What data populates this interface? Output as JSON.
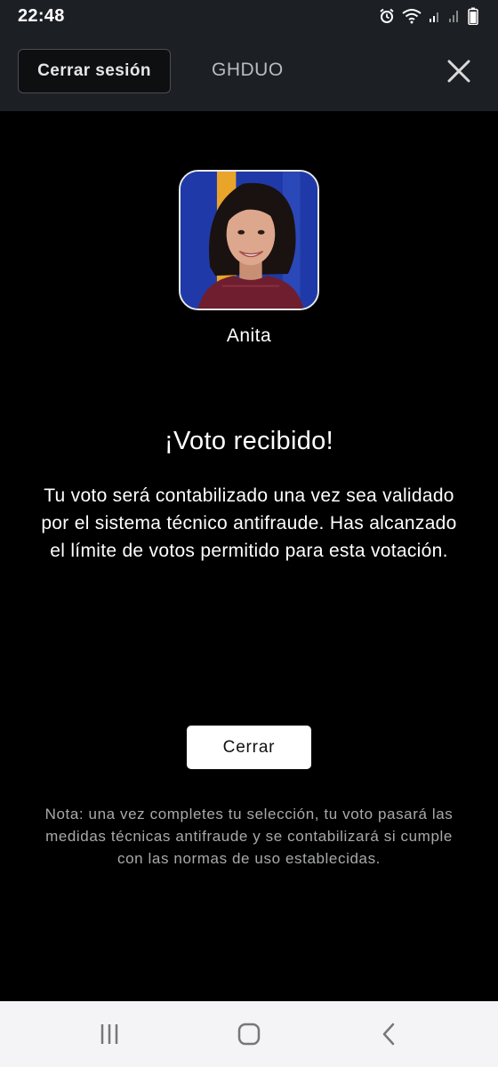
{
  "status_bar": {
    "time": "22:48",
    "icons": [
      "alarm-icon",
      "wifi-icon",
      "signal-icon",
      "signal-icon",
      "battery-icon"
    ]
  },
  "header": {
    "logout_label": "Cerrar sesión",
    "title": "GHDUO",
    "close_icon": "close-icon"
  },
  "contestant": {
    "name": "Anita",
    "photo_colors": {
      "background": "#1f3aa8",
      "stripe": "#e9a42a"
    }
  },
  "confirmation": {
    "heading": "¡Voto recibido!",
    "message": "Tu voto será contabilizado una vez sea validado por el sistema técnico antifraude. Has alcanzado el límite de votos permitido para esta votación."
  },
  "close_button_label": "Cerrar",
  "footnote": "Nota: una vez completes tu selección, tu voto pasará las medidas técnicas antifraude y se contabilizará si cumple con las normas de uso establecidas.",
  "nav_bar": {
    "recent": "recent-apps-icon",
    "home": "home-icon",
    "back": "back-icon"
  }
}
